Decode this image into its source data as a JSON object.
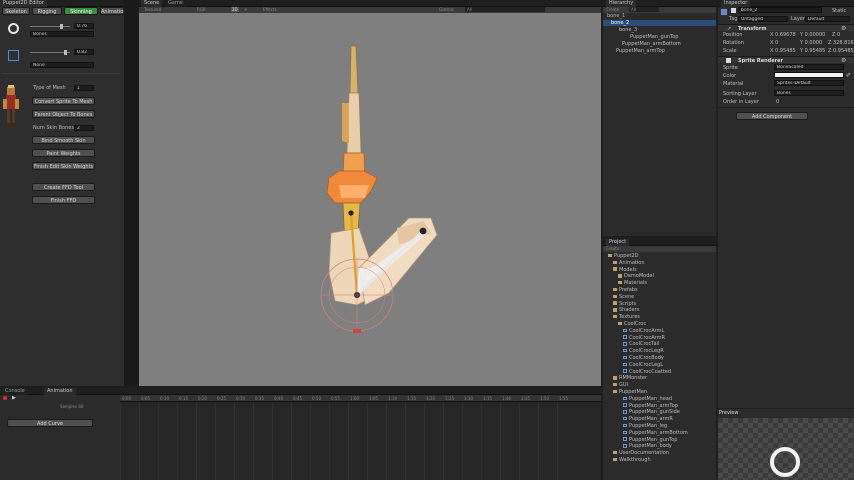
{
  "colors": {
    "accent": "#3e8a3e",
    "panel": "#2b2b2b",
    "scene": "#7f7f7f",
    "selection": "#2a4d7a",
    "bone": "#e6a23c"
  },
  "puppet2d": {
    "title": "Puppet2D Editor",
    "tabs": [
      "Skeleton",
      "Rigging",
      "Skinning",
      "Animation"
    ],
    "active_tab": "Skinning",
    "slider1": "0.76",
    "dropdown1": "Bones",
    "slider2": "0.82",
    "dropdown2": "None",
    "type_of_mesh_label": "Type of Mesh",
    "type_of_mesh_value": "1",
    "buttons": [
      "Convert Sprite To Mesh",
      "Parent Object To Bones"
    ],
    "num_skin_bones_label": "Num Skin Bones",
    "num_skin_bones_value": "2",
    "buttons2": [
      "Bind Smooth Skin",
      "Paint Weights",
      "Finish Edit Skin Weights"
    ],
    "buttons3": [
      "Create FFD Tool",
      "Finish FFD"
    ]
  },
  "scene": {
    "tabs": [
      "Scene",
      "Game"
    ],
    "toolbar": [
      "Textured",
      "RGB",
      "2D",
      "☀",
      "Effects",
      "Gizmos",
      "All"
    ]
  },
  "hierarchy": {
    "tab": "Hierarchy",
    "create": "Create",
    "search": "All",
    "items": [
      "bone_1",
      "bone_2",
      "bone_3",
      "PuppetMan_gunTop",
      "PuppetMan_armBottom",
      "PuppetMan_armTop"
    ]
  },
  "inspector": {
    "tab": "Inspector",
    "object_name": "bone_2",
    "static": "Static",
    "tag_label": "Tag",
    "tag_value": "Untagged",
    "layer_label": "Layer",
    "layer_value": "Default",
    "transform": "Transform",
    "position_label": "Position",
    "position": [
      "X 0.69678",
      "Y 0.00000",
      "Z 0"
    ],
    "rotation_label": "Rotation",
    "rotation": [
      "X 0",
      "Y 0.0000",
      "Z 328.816"
    ],
    "scale_label": "Scale",
    "scale": [
      "X 0.95485",
      "Y 0.95485",
      "Z 0.95485"
    ],
    "sprite_renderer": "Sprite Renderer",
    "sprite_label": "Sprite",
    "sprite_value": "BoneScaled",
    "color_label": "Color",
    "material_label": "Material",
    "material_value": "Sprites-Default",
    "sorting_layer_label": "Sorting Layer",
    "sorting_layer_value": "Bones",
    "order_label": "Order in Layer",
    "order_value": "0",
    "add_component": "Add Component"
  },
  "project": {
    "tab": "Project",
    "create": "Create",
    "items": [
      "Puppet2D",
      "Animation",
      "Models",
      "DemoModel",
      "Materials",
      "Prefabs",
      "Scene",
      "Scripts",
      "Shaders",
      "Textures",
      "CoolCroc",
      "CoolCrocArmL",
      "CoolCrocArmR",
      "CoolCrocTail",
      "CoolCrocLegR",
      "CoolCrocBody",
      "CoolCrocLegL",
      "CoolCrocCoatted",
      "RMMonster",
      "GUI",
      "PuppetMan",
      "PuppetMan_head",
      "PuppetMan_armTop",
      "PuppetMan_gunSide",
      "PuppetMan_armR",
      "PuppetMan_leg",
      "PuppetMan_armBottom",
      "PuppetMan_gunTop",
      "PuppetMan_body",
      "UserDocumentation",
      "Walkthrough"
    ]
  },
  "preview": {
    "tab": "Preview"
  },
  "bottom": {
    "tabs": [
      "Console",
      "Animation"
    ],
    "add_curve": "Add Curve",
    "samples": "Samples 60",
    "timeline": [
      "0:00",
      "0:05",
      "0:10",
      "0:15",
      "0:20",
      "0:25",
      "0:30",
      "0:35",
      "0:40",
      "0:45",
      "0:50",
      "0:55",
      "1:00",
      "1:05",
      "1:10",
      "1:15",
      "1:20",
      "1:25",
      "1:30",
      "1:35",
      "1:40",
      "1:45",
      "1:50",
      "1:55"
    ]
  }
}
